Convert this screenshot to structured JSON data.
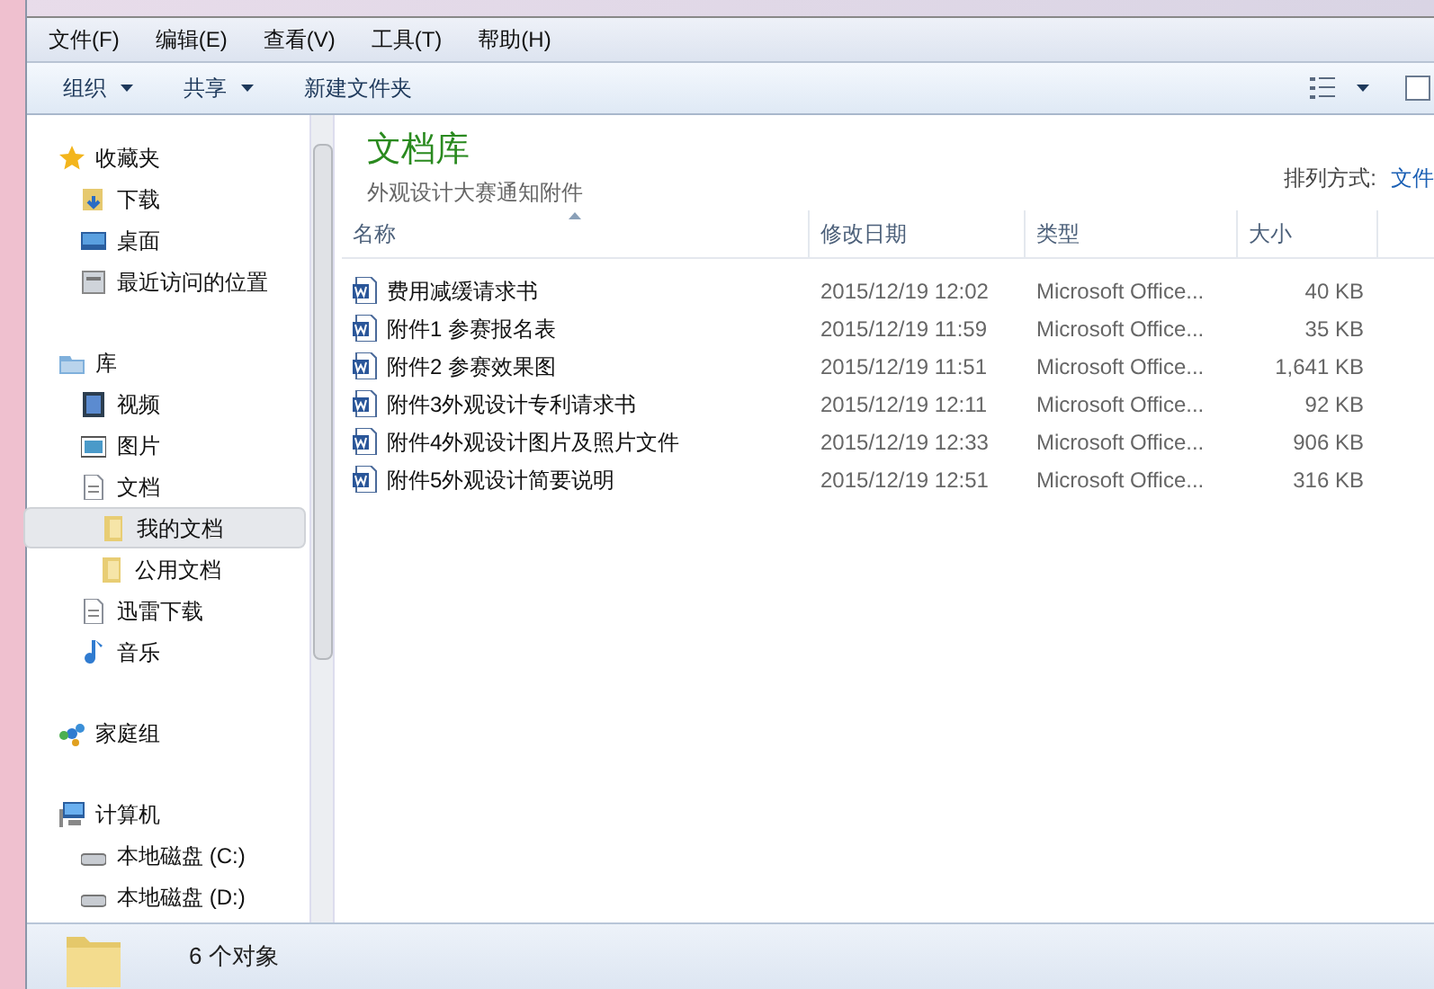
{
  "menu_bar": [
    "文件(F)",
    "编辑(E)",
    "查看(V)",
    "工具(T)",
    "帮助(H)"
  ],
  "toolbar": [
    {
      "label": "组织",
      "dropdown": true
    },
    {
      "label": "共享",
      "dropdown": true
    },
    {
      "label": "新建文件夹",
      "dropdown": false
    }
  ],
  "sidebar": {
    "groups": [
      {
        "label": "收藏夹",
        "kind": "star",
        "children": [
          {
            "label": "下载",
            "kind": "download",
            "selected": false
          },
          {
            "label": "桌面",
            "kind": "desktop",
            "selected": false
          },
          {
            "label": "最近访问的位置",
            "kind": "recent",
            "selected": false
          }
        ]
      },
      {
        "label": "库",
        "kind": "library",
        "children": [
          {
            "label": "视频",
            "kind": "video",
            "selected": false
          },
          {
            "label": "图片",
            "kind": "picture",
            "selected": false
          },
          {
            "label": "文档",
            "kind": "document",
            "selected": false,
            "children": [
              {
                "label": "我的文档",
                "kind": "folder",
                "selected": true
              },
              {
                "label": "公用文档",
                "kind": "folder",
                "selected": false
              }
            ]
          },
          {
            "label": "迅雷下载",
            "kind": "document",
            "selected": false
          },
          {
            "label": "音乐",
            "kind": "music",
            "selected": false
          }
        ]
      },
      {
        "label": "家庭组",
        "kind": "homegroup"
      },
      {
        "label": "计算机",
        "kind": "computer",
        "children": [
          {
            "label": "本地磁盘 (C:)",
            "kind": "drive",
            "selected": false
          },
          {
            "label": "本地磁盘 (D:)",
            "kind": "drive",
            "selected": false
          }
        ]
      }
    ]
  },
  "library": {
    "title": "文档库",
    "subtitle": "外观设计大赛通知附件",
    "arrange_label": "排列方式:",
    "arrange_value": "文件"
  },
  "table": {
    "columns": [
      "名称",
      "修改日期",
      "类型",
      "大小"
    ],
    "rows": [
      [
        "费用减缓请求书",
        "2015/12/19 12:02",
        "Microsoft Office...",
        "40 KB"
      ],
      [
        "附件1 参赛报名表",
        "2015/12/19 11:59",
        "Microsoft Office...",
        "35 KB"
      ],
      [
        "附件2 参赛效果图",
        "2015/12/19 11:51",
        "Microsoft Office...",
        "1,641 KB"
      ],
      [
        "附件3外观设计专利请求书",
        "2015/12/19 12:11",
        "Microsoft Office...",
        "92 KB"
      ],
      [
        "附件4外观设计图片及照片文件",
        "2015/12/19 12:33",
        "Microsoft Office...",
        "906 KB"
      ],
      [
        "附件5外观设计简要说明",
        "2015/12/19 12:51",
        "Microsoft Office...",
        "316 KB"
      ]
    ]
  },
  "status_bar": {
    "count": "6 个对象"
  }
}
